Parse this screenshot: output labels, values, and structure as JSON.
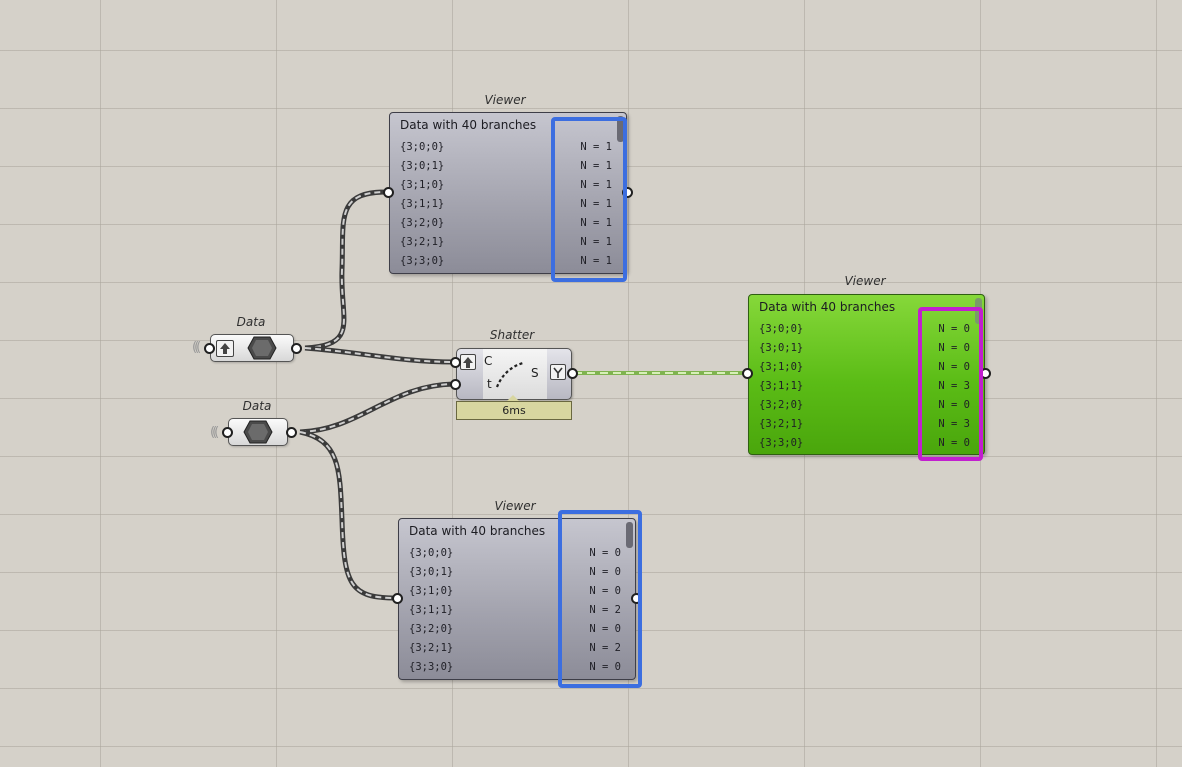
{
  "nodes": {
    "viewer_top": {
      "caption": "Viewer",
      "title": "Data with 40 branches",
      "rows": [
        {
          "path": "{3;0;0}",
          "count": "N = 1"
        },
        {
          "path": "{3;0;1}",
          "count": "N = 1"
        },
        {
          "path": "{3;1;0}",
          "count": "N = 1"
        },
        {
          "path": "{3;1;1}",
          "count": "N = 1"
        },
        {
          "path": "{3;2;0}",
          "count": "N = 1"
        },
        {
          "path": "{3;2;1}",
          "count": "N = 1"
        },
        {
          "path": "{3;3;0}",
          "count": "N = 1"
        }
      ]
    },
    "viewer_right": {
      "caption": "Viewer",
      "title": "Data with 40 branches",
      "rows": [
        {
          "path": "{3;0;0}",
          "count": "N = 0"
        },
        {
          "path": "{3;0;1}",
          "count": "N = 0"
        },
        {
          "path": "{3;1;0}",
          "count": "N = 0"
        },
        {
          "path": "{3;1;1}",
          "count": "N = 3"
        },
        {
          "path": "{3;2;0}",
          "count": "N = 0"
        },
        {
          "path": "{3;2;1}",
          "count": "N = 3"
        },
        {
          "path": "{3;3;0}",
          "count": "N = 0"
        }
      ]
    },
    "viewer_bottom": {
      "caption": "Viewer",
      "title": "Data with 40 branches",
      "rows": [
        {
          "path": "{3;0;0}",
          "count": "N = 0"
        },
        {
          "path": "{3;0;1}",
          "count": "N = 0"
        },
        {
          "path": "{3;1;0}",
          "count": "N = 0"
        },
        {
          "path": "{3;1;1}",
          "count": "N = 2"
        },
        {
          "path": "{3;2;0}",
          "count": "N = 0"
        },
        {
          "path": "{3;2;1}",
          "count": "N = 2"
        },
        {
          "path": "{3;3;0}",
          "count": "N = 0"
        }
      ]
    },
    "data_1": {
      "caption": "Data"
    },
    "data_2": {
      "caption": "Data"
    },
    "shatter": {
      "caption": "Shatter",
      "input_c": "C",
      "input_t": "t",
      "output_s": "S",
      "timer": "6ms"
    }
  },
  "colors": {
    "canvas": "#d5d1c9",
    "highlight_blue": "#3c6ee0",
    "highlight_magenta": "#c21fcf",
    "panel_green": "#5bbc16",
    "panel_grey": "#a2a2ad",
    "wire_dark": "#4a4a4a",
    "wire_green": "#9acb6a"
  },
  "icons": [
    "grasshopper-hexagon-icon",
    "upload-arrow-icon",
    "graft-tree-icon",
    "curve-points-icon"
  ]
}
